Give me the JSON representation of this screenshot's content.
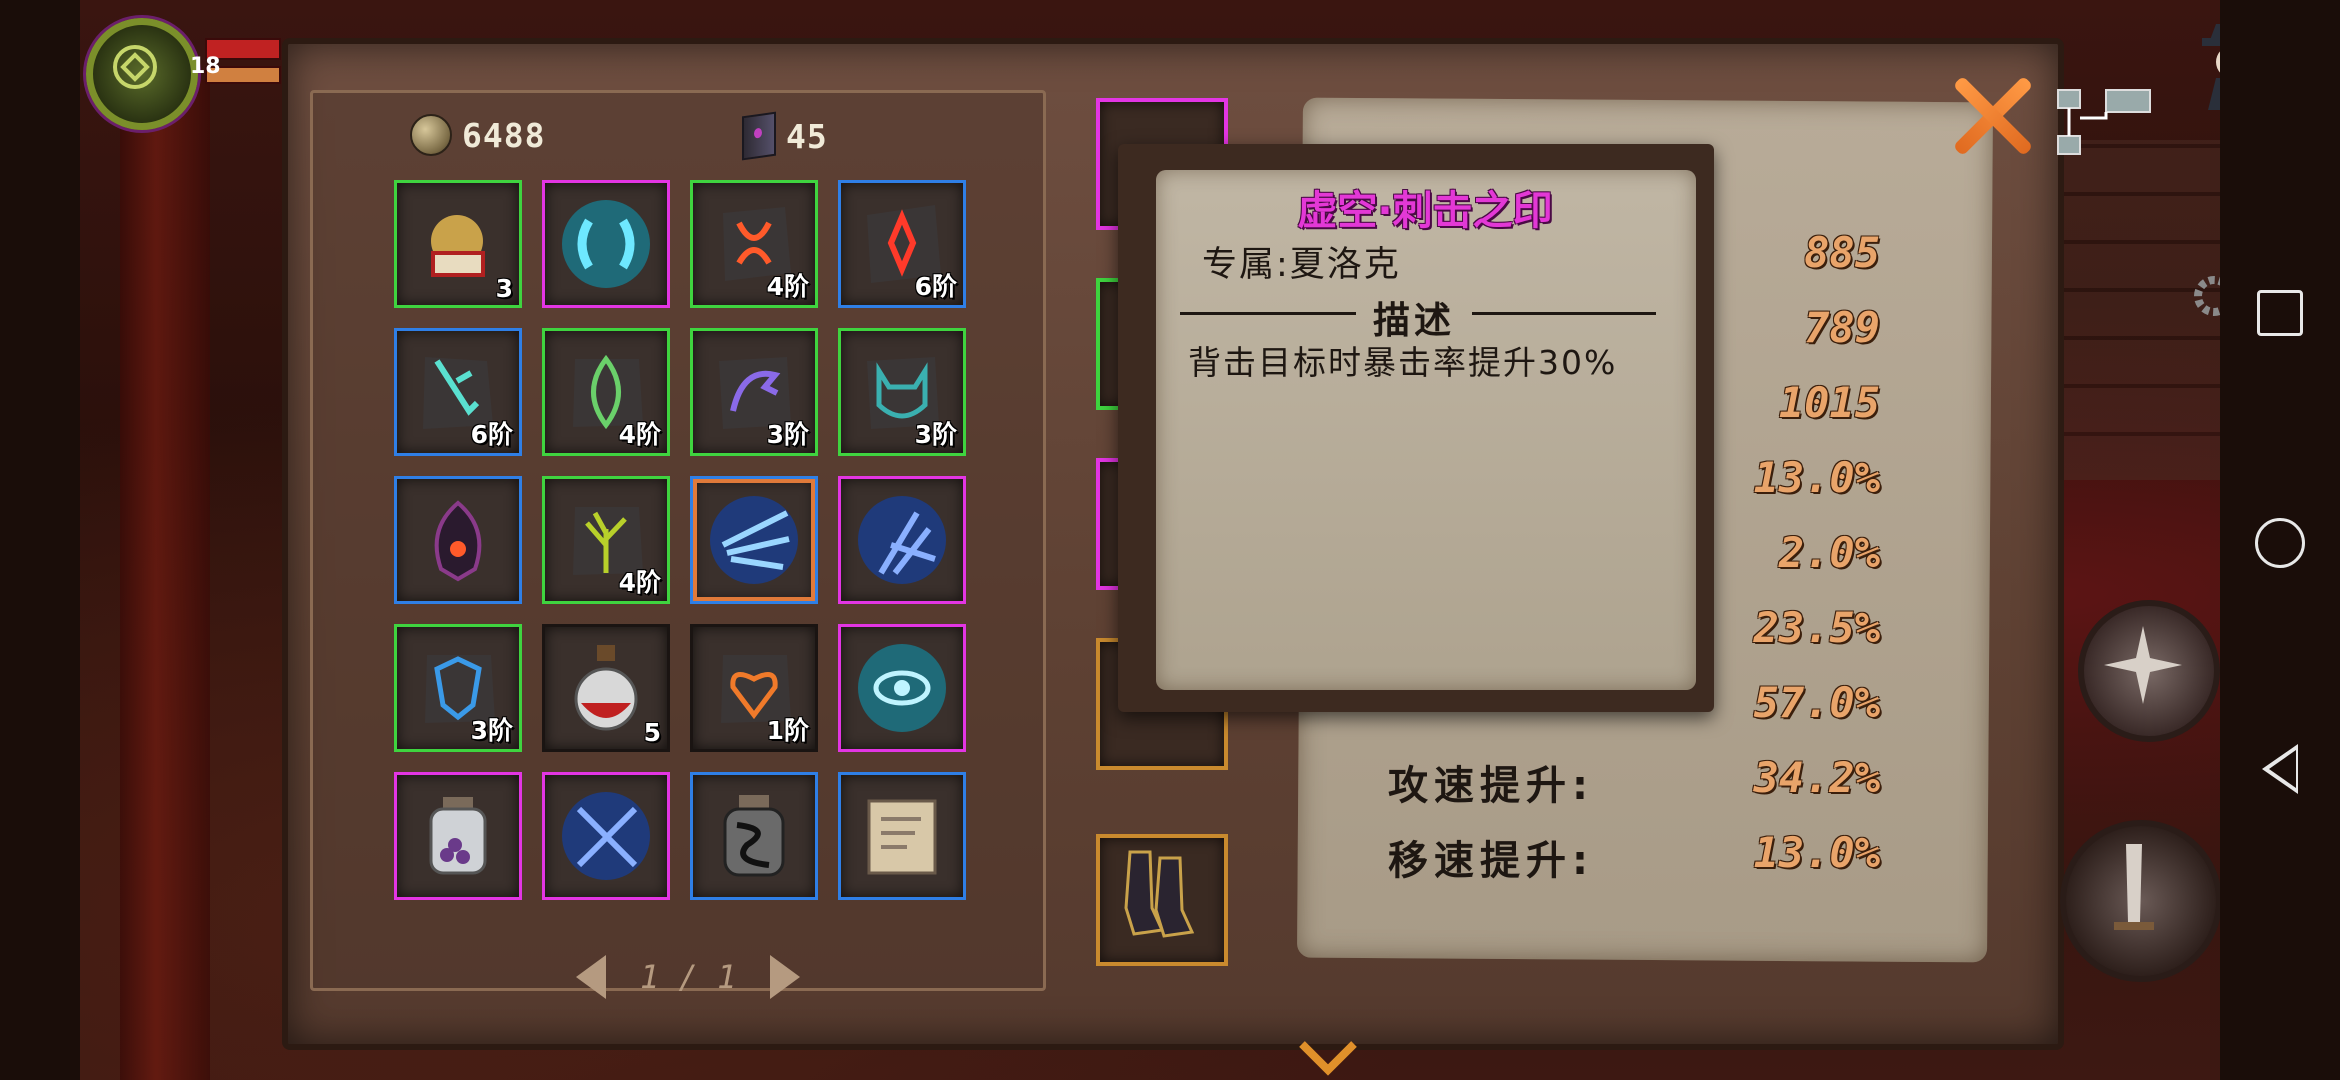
{
  "hud": {
    "level": "18"
  },
  "currencies": {
    "gold": "6488",
    "books": "45"
  },
  "inventory": [
    {
      "rarity": "green",
      "icon": "gift-bell-icon",
      "rank": "3"
    },
    {
      "rarity": "magenta",
      "icon": "void-rune-icon",
      "rank": ""
    },
    {
      "rarity": "green",
      "icon": "flame-rune-icon",
      "rank": "4阶"
    },
    {
      "rarity": "blue",
      "icon": "fire-rune-icon",
      "rank": "6阶"
    },
    {
      "rarity": "blue",
      "icon": "sword-rune-icon",
      "rank": "6阶"
    },
    {
      "rarity": "green",
      "icon": "leaf-rune-icon",
      "rank": "4阶"
    },
    {
      "rarity": "green",
      "icon": "eagle-rune-icon",
      "rank": "3阶"
    },
    {
      "rarity": "green",
      "icon": "cat-rune-icon",
      "rank": "3阶"
    },
    {
      "rarity": "blue",
      "icon": "dark-gem-icon",
      "rank": ""
    },
    {
      "rarity": "green",
      "icon": "tree-rune-icon",
      "rank": "4阶"
    },
    {
      "rarity": "blue",
      "icon": "strike-seal-icon",
      "rank": "",
      "selected": true
    },
    {
      "rarity": "magenta",
      "icon": "blade-seal-icon",
      "rank": ""
    },
    {
      "rarity": "green",
      "icon": "shield-rune-icon",
      "rank": "3阶"
    },
    {
      "rarity": "none",
      "icon": "red-potion-icon",
      "rank": "5"
    },
    {
      "rarity": "none",
      "icon": "heart-rune-icon",
      "rank": "1阶"
    },
    {
      "rarity": "magenta",
      "icon": "eye-seal-icon",
      "rank": ""
    },
    {
      "rarity": "magenta",
      "icon": "berry-jar-icon",
      "rank": ""
    },
    {
      "rarity": "magenta",
      "icon": "cross-blades-icon",
      "rank": ""
    },
    {
      "rarity": "blue",
      "icon": "ink-jar-icon",
      "rank": ""
    },
    {
      "rarity": "blue",
      "icon": "map-scroll-icon",
      "rank": ""
    }
  ],
  "pager": {
    "text": "1 / 1"
  },
  "stats": [
    {
      "label": "",
      "value": "885"
    },
    {
      "label": "",
      "value": "789"
    },
    {
      "label": "",
      "value": "1015"
    },
    {
      "label": "",
      "value": "13.0%"
    },
    {
      "label": "",
      "value": "2.0%"
    },
    {
      "label": "",
      "value": "23.5%"
    },
    {
      "label": "",
      "value": "57.0%"
    },
    {
      "label": "攻速提升:",
      "value": "34.2%"
    },
    {
      "label": "移速提升:",
      "value": "13.0%"
    }
  ],
  "tooltip": {
    "title": "虚空·刺击之印",
    "exclusive": "专属:夏洛克",
    "heading": "描述",
    "description": "背击目标时暴击率提升30%"
  },
  "colors": {
    "green": "#3fd43f",
    "magenta": "#e335e3",
    "blue": "#2f7fe6",
    "title": "#e338d6",
    "stat_value": "#e9a46a",
    "close": "#ff9a45"
  }
}
